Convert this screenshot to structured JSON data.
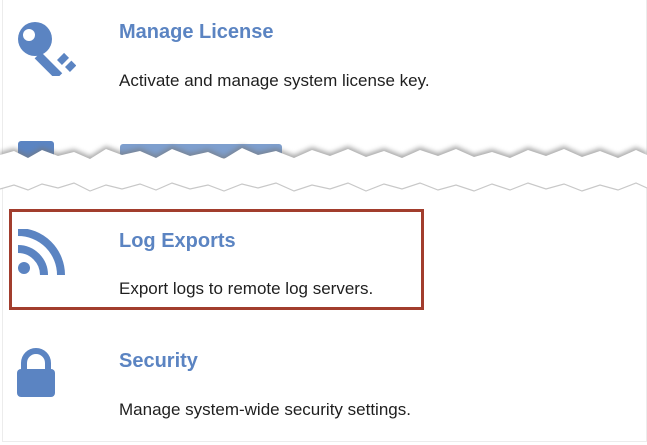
{
  "items": [
    {
      "title": "Manage License",
      "description": "Activate and manage system license key.",
      "icon": "key-icon"
    },
    {
      "title": "Network Settings",
      "description": "",
      "icon": "network-icon"
    },
    {
      "title": "Log Exports",
      "description": "Export logs to remote log servers.",
      "icon": "rss-icon"
    },
    {
      "title": "Security",
      "description": "Manage system-wide security settings.",
      "icon": "lock-icon"
    }
  ],
  "colors": {
    "accent": "#5b84c2",
    "highlight_border": "#a23d2d",
    "text": "#1f1f1f"
  }
}
